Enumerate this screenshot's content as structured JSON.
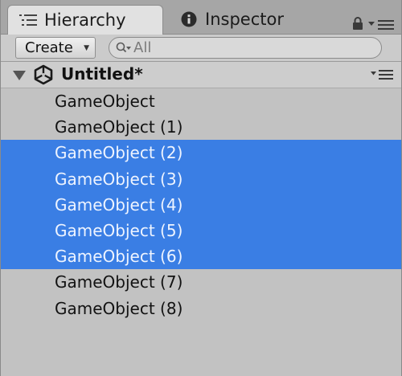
{
  "tabs": [
    {
      "label": "Hierarchy",
      "icon": "list-icon",
      "active": true
    },
    {
      "label": "Inspector",
      "icon": "info-icon",
      "active": false
    }
  ],
  "tab_controls": {
    "lock_icon": "lock-icon",
    "menu_icon": "tab-menu-icon"
  },
  "toolbar": {
    "create_label": "Create",
    "create_caret": "▼",
    "search_placeholder": "All",
    "search_value": ""
  },
  "scene": {
    "title": "Untitled*",
    "expanded": true
  },
  "objects": [
    {
      "name": "GameObject",
      "selected": false
    },
    {
      "name": "GameObject (1)",
      "selected": false
    },
    {
      "name": "GameObject (2)",
      "selected": true
    },
    {
      "name": "GameObject (3)",
      "selected": true
    },
    {
      "name": "GameObject (4)",
      "selected": true
    },
    {
      "name": "GameObject (5)",
      "selected": true
    },
    {
      "name": "GameObject (6)",
      "selected": true
    },
    {
      "name": "GameObject (7)",
      "selected": false
    },
    {
      "name": "GameObject (8)",
      "selected": false
    }
  ],
  "colors": {
    "selection": "#3a7ee4",
    "panel_bg": "#c2c2c2",
    "tab_active_bg": "#e1e1e1"
  }
}
